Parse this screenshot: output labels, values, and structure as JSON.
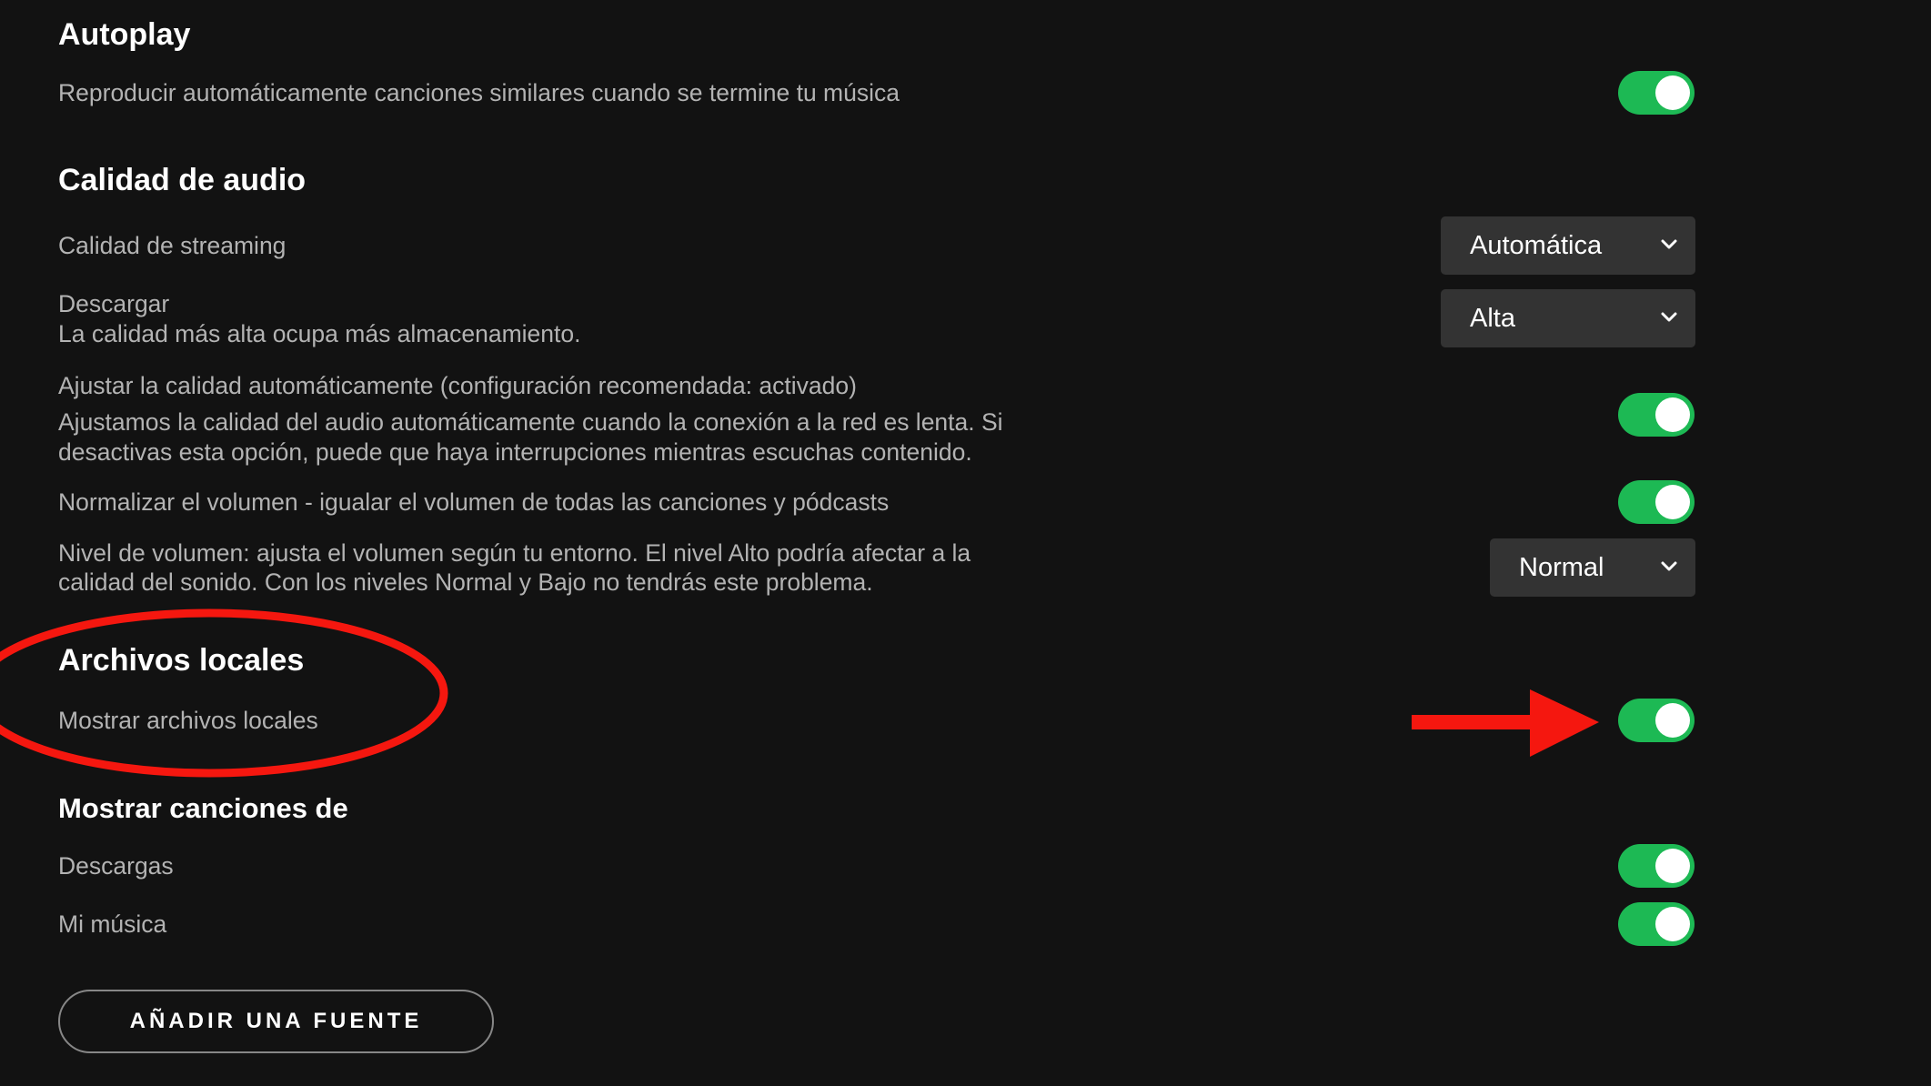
{
  "autoplay": {
    "title": "Autoplay",
    "description": "Reproducir automáticamente canciones similares cuando se termine tu música",
    "toggle_on": true
  },
  "audio_quality": {
    "title": "Calidad de audio",
    "streaming": {
      "label": "Calidad de streaming",
      "selected": "Automática"
    },
    "download": {
      "label": "Descargar",
      "sublabel": "La calidad más alta ocupa más almacenamiento.",
      "selected": "Alta"
    },
    "auto_adjust": {
      "label": "Ajustar la calidad automáticamente (configuración recomendada: activado)",
      "line1": "Ajustamos la calidad del audio automáticamente cuando la conexión a la red es lenta. Si",
      "line2": "desactivas esta opción, puede que haya interrupciones mientras escuchas contenido.",
      "toggle_on": true
    },
    "normalize": {
      "label": "Normalizar el volumen - igualar el volumen de todas las canciones y pódcasts",
      "toggle_on": true
    },
    "volume_level": {
      "line1": "Nivel de volumen: ajusta el volumen según tu entorno. El nivel Alto podría afectar a la",
      "line2": "calidad del sonido. Con los niveles Normal y Bajo no tendrás este problema.",
      "selected": "Normal"
    }
  },
  "local_files": {
    "title": "Archivos locales",
    "show_label": "Mostrar archivos locales",
    "toggle_on": true
  },
  "show_songs_from": {
    "title": "Mostrar canciones de",
    "downloads": {
      "label": "Descargas",
      "toggle_on": true
    },
    "my_music": {
      "label": "Mi música",
      "toggle_on": true
    }
  },
  "add_source_button": "AÑADIR UNA FUENTE",
  "colors": {
    "background": "#121212",
    "accent_green": "#1db954",
    "annotation_red": "#f5170f",
    "select_bg": "#333333"
  },
  "icons": {
    "dropdown": "chevron-down-icon",
    "annotation_arrow": "arrow-right-icon",
    "annotation_circle": "ellipse-highlight"
  }
}
